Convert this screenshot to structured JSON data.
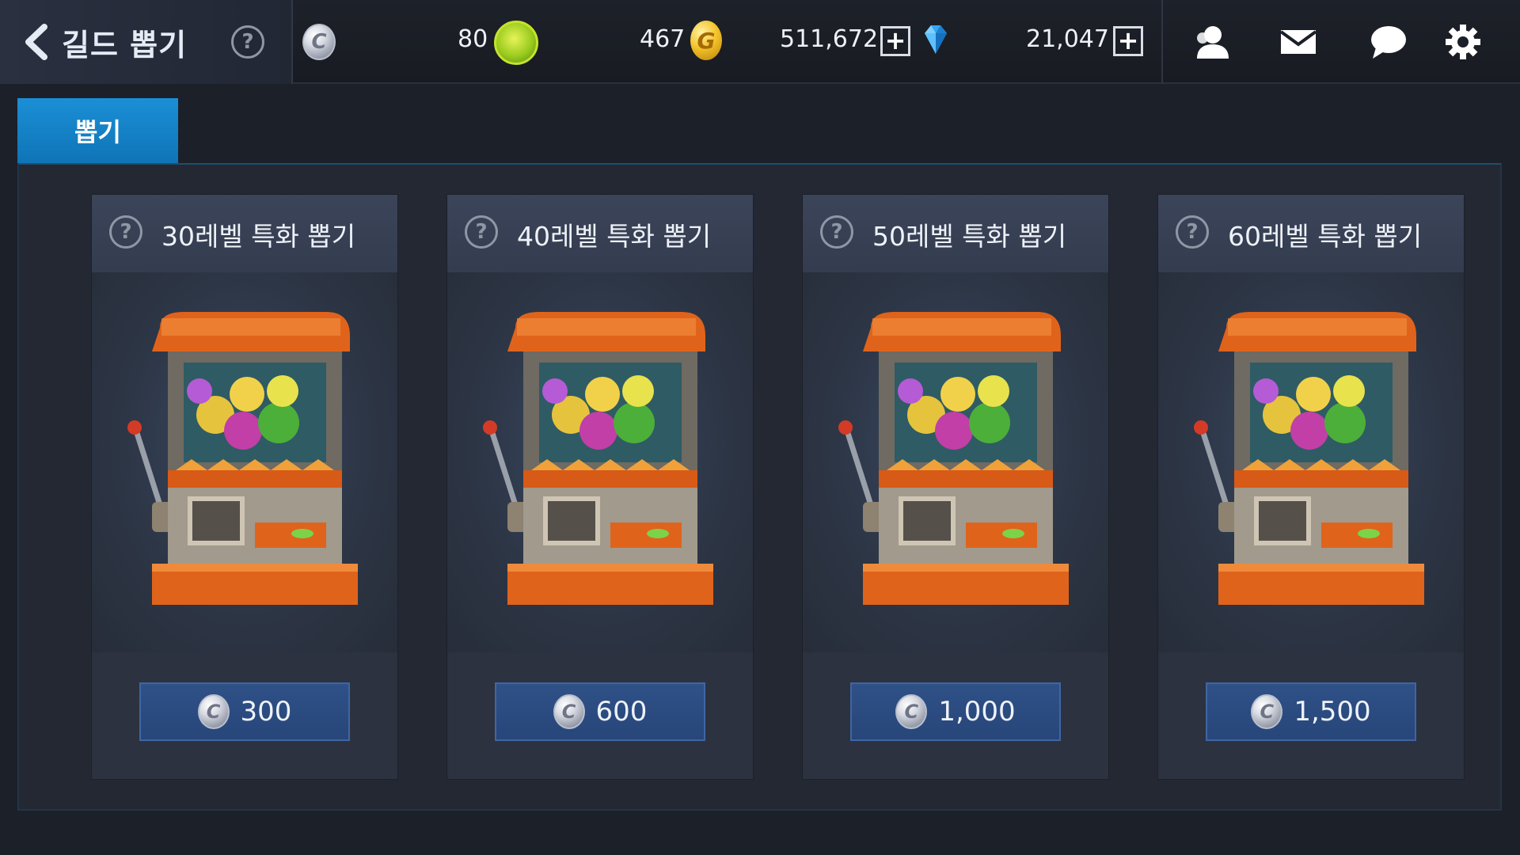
{
  "header": {
    "title": "길드 뽑기",
    "help_glyph": "?",
    "guild_coin_glyph": "C"
  },
  "resources": {
    "laurel": {
      "value": "80",
      "icon": "laurel-coin-icon"
    },
    "gold": {
      "value": "467",
      "icon": "gold-coin-icon",
      "glyph": "G"
    },
    "gems": {
      "value": "511,672",
      "icon": "diamond-icon"
    },
    "other": {
      "value": "21,047"
    },
    "plus_glyph": "+"
  },
  "tabs": [
    {
      "label": "뽑기",
      "active": true
    }
  ],
  "cards": [
    {
      "title": "30레벨 특화 뽑기",
      "price": "300"
    },
    {
      "title": "40레벨 특화 뽑기",
      "price": "600"
    },
    {
      "title": "50레벨 특화 뽑기",
      "price": "1,000"
    },
    {
      "title": "60레벨 특화 뽑기",
      "price": "1,500"
    }
  ],
  "colors": {
    "accent_tab": "#1b8fd6",
    "price_button": "#2f5187",
    "machine_orange": "#e0631b"
  }
}
